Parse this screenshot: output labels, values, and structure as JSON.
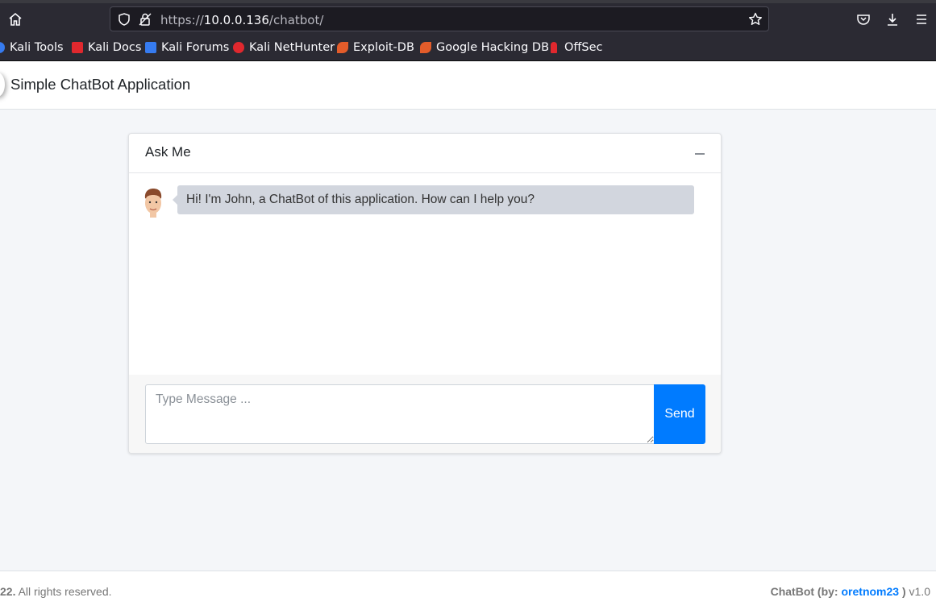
{
  "browser": {
    "url_scheme": "https://",
    "url_host": "10.0.0.136",
    "url_path": "/chatbot/",
    "icons": [
      "home-icon",
      "shield-icon",
      "lock-icon",
      "star-icon",
      "pocket-icon",
      "download-icon",
      "menu-icon"
    ],
    "bookmarks": [
      {
        "label": "Kali Tools",
        "icon_color": "#367bf0"
      },
      {
        "label": "Kali Docs",
        "icon_color": "#e0282e"
      },
      {
        "label": "Kali Forums",
        "icon_color": "#367bf0"
      },
      {
        "label": "Kali NetHunter",
        "icon_color": "#e0282e"
      },
      {
        "label": "Exploit-DB",
        "icon_color": "#e35c2a"
      },
      {
        "label": "Google Hacking DB",
        "icon_color": "#e35c2a"
      },
      {
        "label": "OffSec",
        "icon_color": "#e0282e"
      }
    ]
  },
  "app": {
    "title": "Simple ChatBot Application"
  },
  "card": {
    "title": "Ask Me",
    "messages": [
      {
        "sender": "bot",
        "text": "Hi! I'm John, a ChatBot of this application. How can I help you?"
      }
    ],
    "input_placeholder": "Type Message ...",
    "send_label": "Send",
    "accent": "#007bff"
  },
  "footer": {
    "copyright_prefix": "22.",
    "copyright_rest": " All rights reserved.",
    "credit_prefix": "ChatBot (by: ",
    "credit_author": "oretnom23",
    "credit_suffix": " )",
    "version": " v1.0"
  }
}
